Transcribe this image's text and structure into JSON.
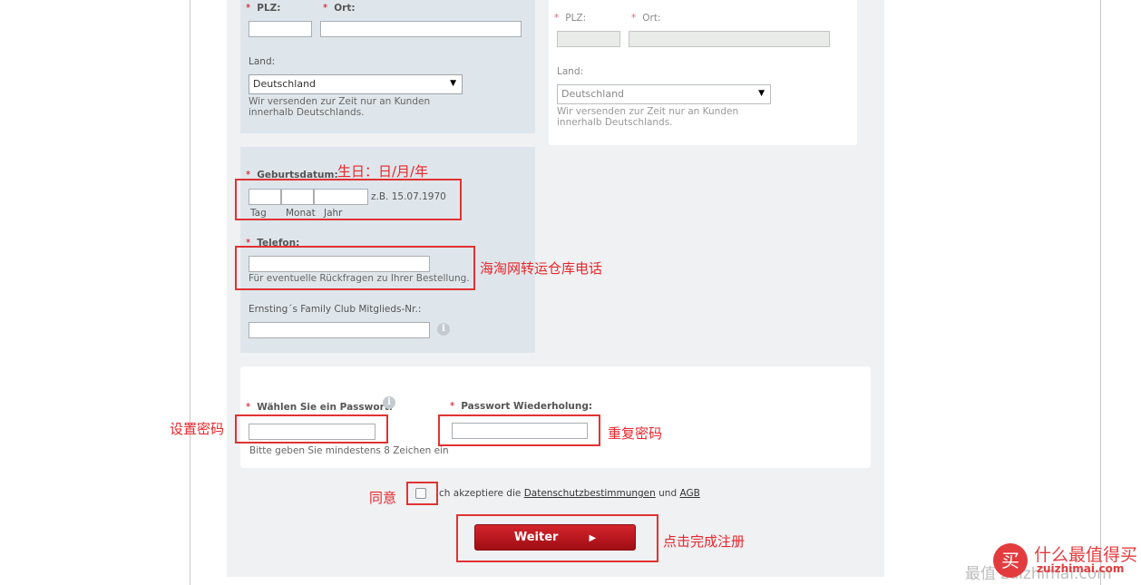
{
  "left_form": {
    "plz_label": "PLZ:",
    "ort_label": "Ort:",
    "land_label": "Land:",
    "land_value": "Deutschland",
    "land_hint": "Wir versenden zur Zeit nur an Kunden innerhalb Deutschlands.",
    "birthdate_label": "Geburtsdatum:",
    "birthdate_example": "z.B. 15.07.1970",
    "birthdate_tag": "Tag",
    "birthdate_monat": "Monat",
    "birthdate_jahr": "Jahr",
    "telefon_label": "Telefon:",
    "telefon_hint": "Für eventuelle Rückfragen zu Ihrer Bestellung.",
    "club_label": "Ernsting´s Family Club Mitglieds-Nr.:"
  },
  "right_form": {
    "plz_label": "PLZ:",
    "ort_label": "Ort:",
    "land_label": "Land:",
    "land_value": "Deutschland",
    "land_hint": "Wir versenden zur Zeit nur an Kunden innerhalb Deutschlands."
  },
  "password": {
    "password_label": "Wählen Sie ein Passwort:",
    "password_hint": "Bitte geben Sie mindestens 8 Zeichen ein",
    "repeat_label": "Passwort Wiederholung:"
  },
  "consent": {
    "prefix": "ch akzeptiere die",
    "privacy_link": "Datenschutzbestimmungen",
    "and": "und",
    "agb_link": "AGB"
  },
  "submit_label": "Weiter",
  "required_marker": "*",
  "info_glyph": "i",
  "annotations": {
    "birthday": "生日：日/月/年",
    "phone": "海淘网转运仓库电话",
    "set_password": "设置密码",
    "repeat_password": "重复密码",
    "agree": "同意",
    "click_finish": "点击完成注册"
  },
  "watermark": {
    "site_name": "什么最值得买",
    "site_url": "zuizhimai.com",
    "faded_text": "最值 zuizhimai.com",
    "logo_glyph": "买"
  },
  "colors": {
    "annotation_red": "#e8262b",
    "panel_blue": "#dfe6eb",
    "panel_grey": "#eff1f3",
    "button_red": "#c0161e"
  },
  "icons": [
    "dropdown-arrow-icon",
    "info-icon",
    "play-arrow-icon",
    "logo-icon"
  ]
}
